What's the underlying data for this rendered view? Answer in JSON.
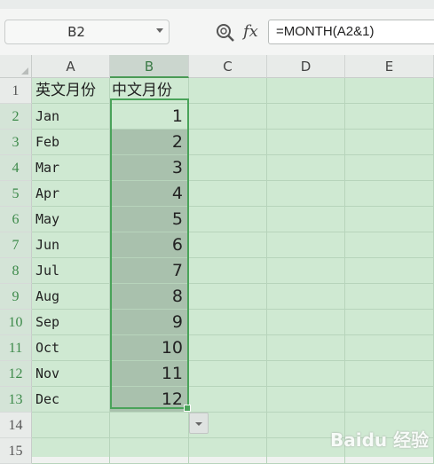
{
  "name_box": {
    "value": "B2"
  },
  "formula_bar": {
    "fx_label": "fx",
    "formula": "=MONTH(A2&1)"
  },
  "columns": [
    "A",
    "B",
    "C",
    "D",
    "E"
  ],
  "selected_column": "B",
  "rows": [
    {
      "num": "1",
      "a": "英文月份",
      "b": "中文月份",
      "header": true
    },
    {
      "num": "2",
      "a": "Jan",
      "b": "1"
    },
    {
      "num": "3",
      "a": "Feb",
      "b": "2"
    },
    {
      "num": "4",
      "a": "Mar",
      "b": "3"
    },
    {
      "num": "5",
      "a": "Apr",
      "b": "4"
    },
    {
      "num": "6",
      "a": "May",
      "b": "5"
    },
    {
      "num": "7",
      "a": "Jun",
      "b": "6"
    },
    {
      "num": "8",
      "a": "Jul",
      "b": "7"
    },
    {
      "num": "9",
      "a": "Aug",
      "b": "8"
    },
    {
      "num": "10",
      "a": "Sep",
      "b": "9"
    },
    {
      "num": "11",
      "a": "Oct",
      "b": "10"
    },
    {
      "num": "12",
      "a": "Nov",
      "b": "11"
    },
    {
      "num": "13",
      "a": "Dec",
      "b": "12"
    },
    {
      "num": "14",
      "a": "",
      "b": ""
    },
    {
      "num": "15",
      "a": "",
      "b": ""
    }
  ],
  "watermark": "Baidu 经验",
  "colors": {
    "sheet_bg": "#cfe9d2",
    "selection_border": "#4aa35a",
    "selected_fill": "#a9c1ad"
  }
}
